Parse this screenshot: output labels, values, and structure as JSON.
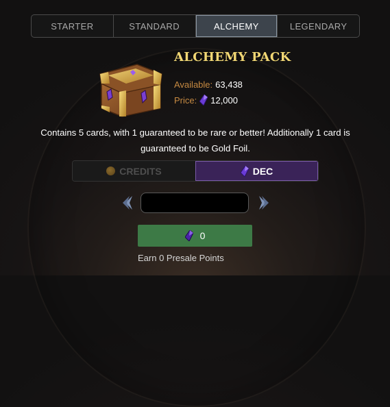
{
  "tabs": [
    {
      "label": "STARTER",
      "active": false
    },
    {
      "label": "STANDARD",
      "active": false
    },
    {
      "label": "ALCHEMY",
      "active": true
    },
    {
      "label": "LEGENDARY",
      "active": false
    }
  ],
  "pack": {
    "title": "ALCHEMY PACK",
    "available_label": "Available:",
    "available_value": "63,438",
    "price_label": "Price:",
    "price_value": "12,000",
    "price_icon": "dec-gem-icon"
  },
  "description": "Contains 5 cards, with 1 guaranteed to be rare or better! Additionally 1 card is guaranteed to be Gold Foil.",
  "currency": {
    "credits_label": "CREDITS",
    "dec_label": "DEC",
    "selected": "DEC"
  },
  "quantity": {
    "value": "",
    "placeholder": ""
  },
  "buy": {
    "amount": "0",
    "icon": "dec-gem-icon"
  },
  "earn_text": "Earn 0 Presale Points",
  "colors": {
    "gold_title": "#f1d774",
    "label_orange": "#c78a42",
    "dec_purple": "#3a2358",
    "buy_green": "#3d7a46",
    "active_tab": "#3d444c"
  }
}
